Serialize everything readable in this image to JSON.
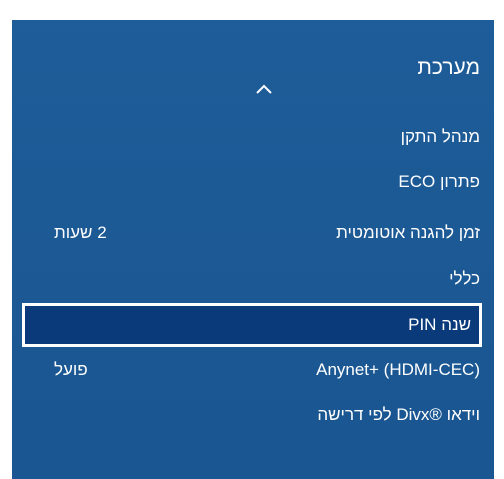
{
  "menu": {
    "title": "מערכת",
    "items": [
      {
        "label": "מנהל התקן",
        "value": ""
      },
      {
        "label": "פתרון ECO",
        "value": ""
      },
      {
        "label": "זמן להגנה אוטומטית",
        "value": "2 שעות"
      },
      {
        "label": "כללי",
        "value": ""
      },
      {
        "label": "שנה PIN",
        "value": "",
        "selected": true
      },
      {
        "label": "Anynet+ (HDMI-CEC)",
        "value": "פועל"
      },
      {
        "label": "וידאו ®Divx לפי דרישה",
        "value": ""
      }
    ]
  },
  "icons": {
    "scroll_up": "chevron-up-icon"
  },
  "colors": {
    "background": "#1c5a96",
    "selected_background": "#0b3a7b",
    "selected_border": "#ffffff",
    "text": "#ffffff"
  }
}
